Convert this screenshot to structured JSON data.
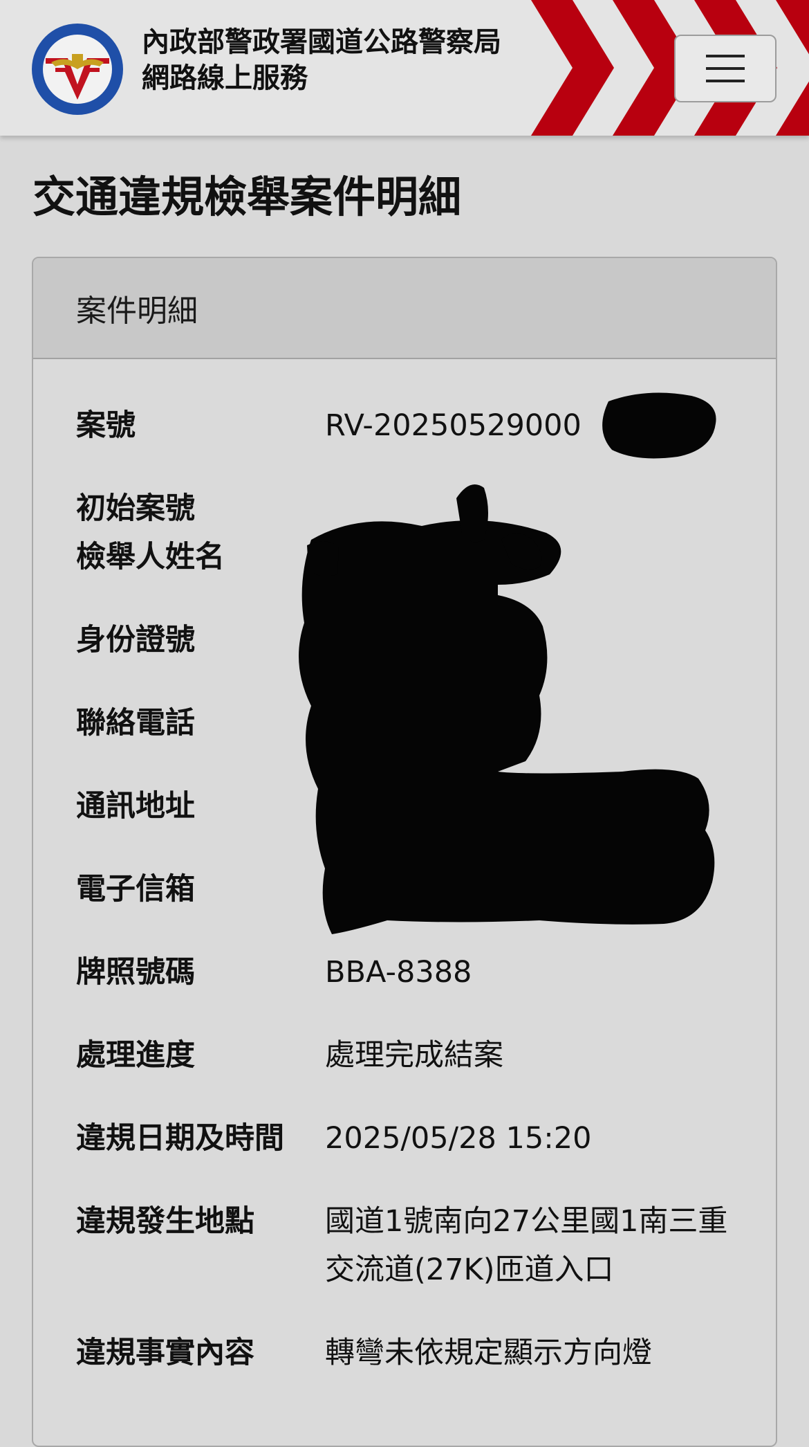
{
  "header": {
    "agency_name": "內政部警政署國道公路警察局",
    "service_name": "網路線上服務",
    "logo_icon": "police-emblem-icon",
    "menu_icon": "hamburger-menu-icon",
    "colors": {
      "stripe": "#b8000f",
      "header_bg": "#e4e4e4"
    }
  },
  "page": {
    "title": "交通違規檢舉案件明細"
  },
  "card": {
    "title": "案件明細",
    "rows": [
      {
        "label": "案號",
        "value": "RV-20250529000"
      },
      {
        "label": "初始案號",
        "value": ""
      },
      {
        "label": "檢舉人姓名",
        "value": ""
      },
      {
        "label": "身份證號",
        "value": ""
      },
      {
        "label": "聯絡電話",
        "value": ""
      },
      {
        "label": "通訊地址",
        "value": ""
      },
      {
        "label": "電子信箱",
        "value": ""
      },
      {
        "label": "牌照號碼",
        "value": "BBA-8388"
      },
      {
        "label": "處理進度",
        "value": "處理完成結案"
      },
      {
        "label": "違規日期及時間",
        "value": "2025/05/28 15:20"
      },
      {
        "label": "違規發生地點",
        "value": "國道1號南向27公里國1南三重交流道(27K)匝道入口"
      },
      {
        "label": "違規事實內容",
        "value": "轉彎未依規定顯示方向燈"
      }
    ]
  }
}
